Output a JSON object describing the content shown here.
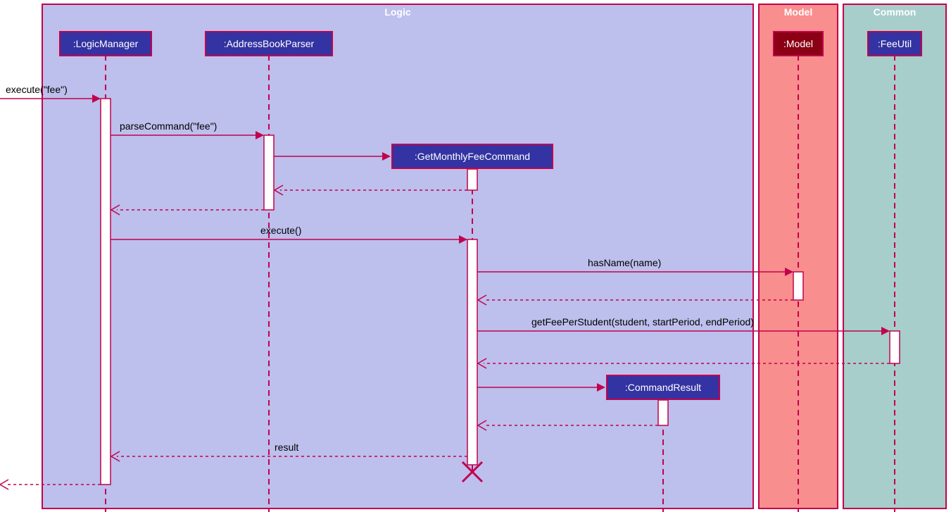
{
  "containers": {
    "logic": {
      "label": "Logic"
    },
    "model": {
      "label": "Model"
    },
    "common": {
      "label": "Common"
    }
  },
  "participants": {
    "logicManager": {
      "label": ":LogicManager"
    },
    "addressBookParser": {
      "label": ":AddressBookParser"
    },
    "getMonthlyFeeCommand": {
      "label": ":GetMonthlyFeeCommand"
    },
    "commandResult": {
      "label": ":CommandResult"
    },
    "model": {
      "label": ":Model"
    },
    "feeUtil": {
      "label": ":FeeUtil"
    }
  },
  "messages": {
    "execute_fee": "execute(\"fee\")",
    "parseCommand": "parseCommand(\"fee\")",
    "execute": "execute()",
    "hasName": "hasName(name)",
    "getFeePerStudent": "getFeePerStudent(student, startPeriod, endPeriod)",
    "result": "result"
  }
}
